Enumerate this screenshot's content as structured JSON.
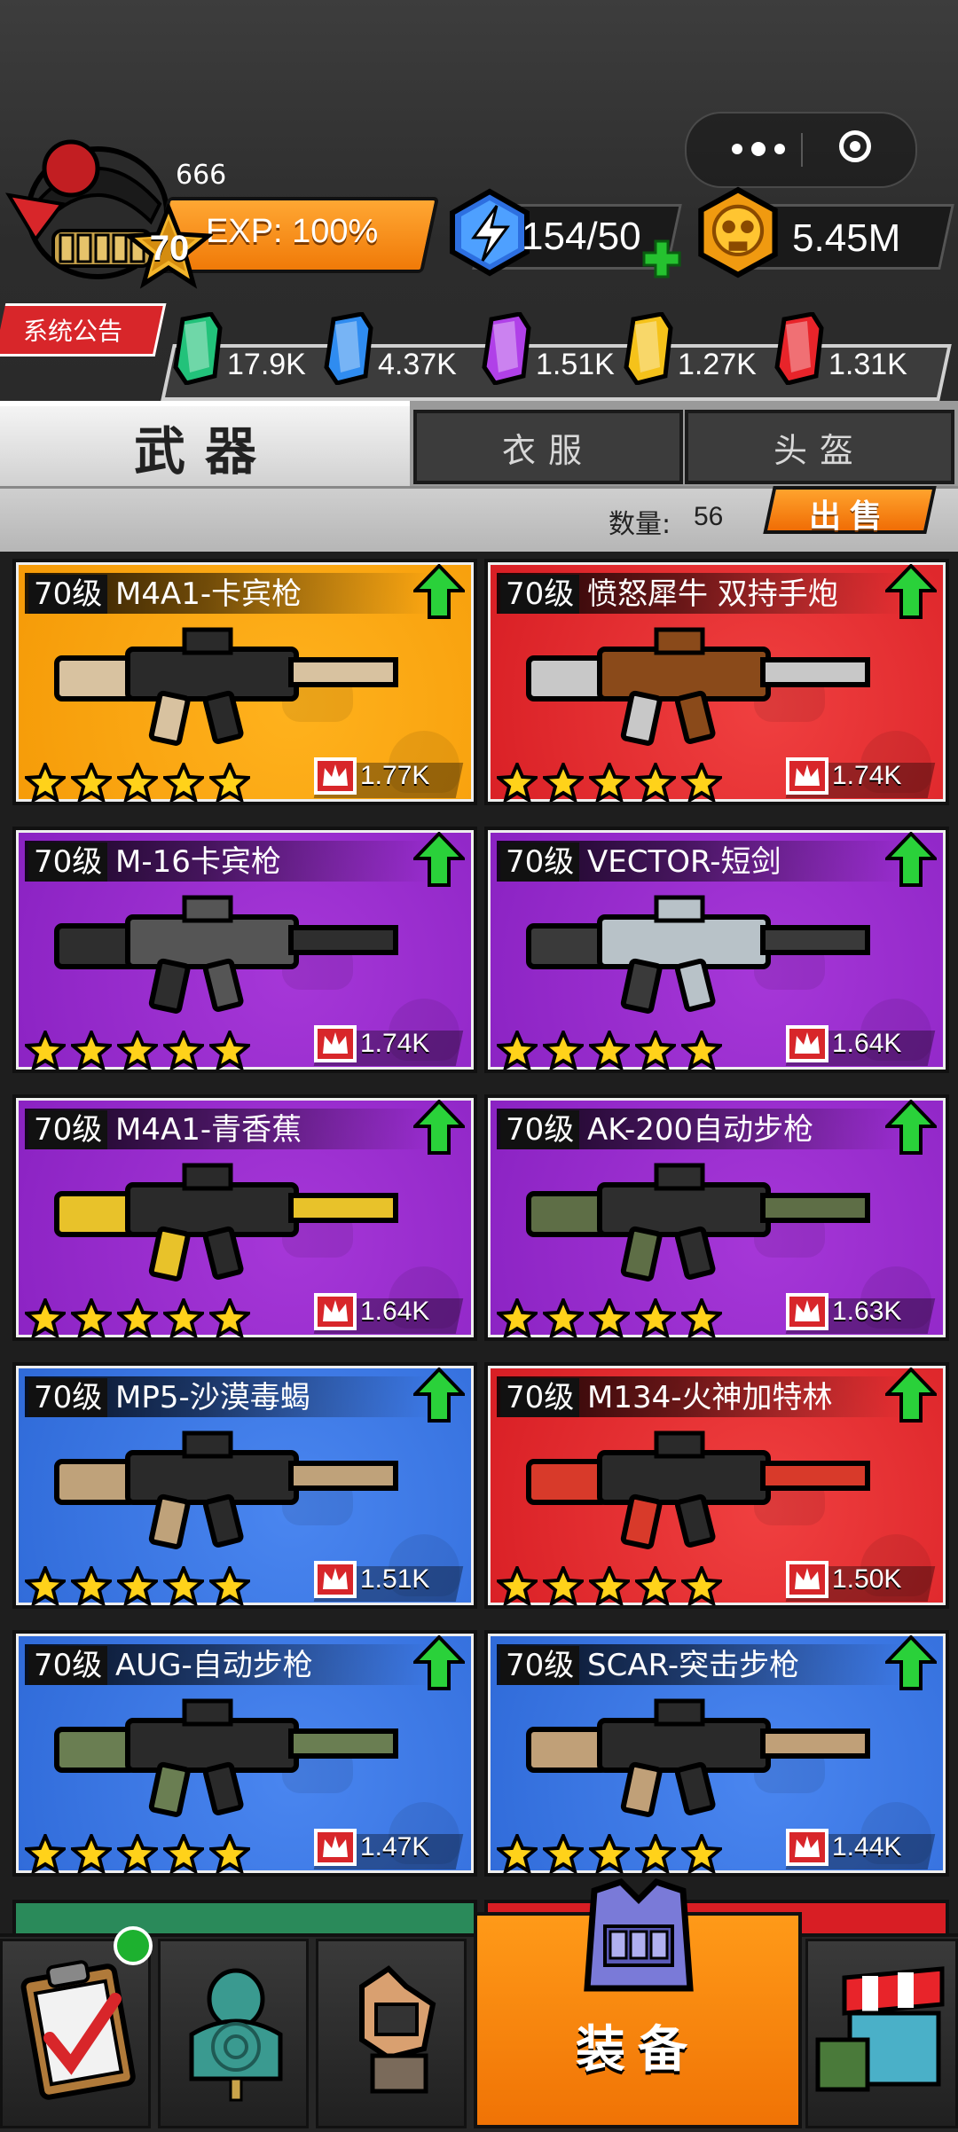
{
  "player": {
    "name": "666",
    "level": "70",
    "exp": "EXP: 100%",
    "energy": "154/50",
    "coins": "5.45M"
  },
  "announcement": "系统公告",
  "gems": [
    {
      "color": "#22c27a",
      "value": "17.9K"
    },
    {
      "color": "#2f8cf0",
      "value": "4.37K"
    },
    {
      "color": "#b040e8",
      "value": "1.51K"
    },
    {
      "color": "#f5c21a",
      "value": "1.27K"
    },
    {
      "color": "#e8242a",
      "value": "1.31K"
    }
  ],
  "tabs": {
    "active": "武器",
    "others": [
      "衣服",
      "头盔"
    ]
  },
  "inventory": {
    "count_label": "数量:",
    "count_value": "56",
    "sell_label": "出售"
  },
  "weapons": [
    {
      "level": "70级",
      "name": "M4A1-卡宾枪",
      "rarity": "orange",
      "stars": 5,
      "power": "1.77K",
      "gun": "m4a1-tan"
    },
    {
      "level": "70级",
      "name": "愤怒犀牛 双持手炮",
      "rarity": "red",
      "stars": 5,
      "power": "1.74K",
      "gun": "revolver-cannon"
    },
    {
      "level": "70级",
      "name": "M-16卡宾枪",
      "rarity": "purple",
      "stars": 5,
      "power": "1.74K",
      "gun": "m16-black"
    },
    {
      "level": "70级",
      "name": "VECTOR-短剑",
      "rarity": "purple",
      "stars": 5,
      "power": "1.64K",
      "gun": "vector"
    },
    {
      "level": "70级",
      "name": "M4A1-青香蕉",
      "rarity": "purple",
      "stars": 5,
      "power": "1.64K",
      "gun": "m4a1-yellow"
    },
    {
      "level": "70级",
      "name": "AK-200自动步枪",
      "rarity": "purple",
      "stars": 5,
      "power": "1.63K",
      "gun": "ak200"
    },
    {
      "level": "70级",
      "name": "MP5-沙漠毒蝎",
      "rarity": "blue",
      "stars": 5,
      "power": "1.51K",
      "gun": "mp5-tan"
    },
    {
      "level": "70级",
      "name": "M134-火神加特林",
      "rarity": "red",
      "stars": 5,
      "power": "1.50K",
      "gun": "minigun"
    },
    {
      "level": "70级",
      "name": "AUG-自动步枪",
      "rarity": "blue",
      "stars": 5,
      "power": "1.47K",
      "gun": "aug-green"
    },
    {
      "level": "70级",
      "name": "SCAR-突击步枪",
      "rarity": "blue",
      "stars": 5,
      "power": "1.44K",
      "gun": "scar-tan"
    }
  ],
  "nav": {
    "items": [
      "clipboard-icon",
      "target-icon",
      "glove-icon",
      "armor-vest-icon",
      "shop-icon"
    ],
    "active_label": "装备"
  },
  "colors": {
    "orange": "#f59a07",
    "red": "#d81e24",
    "purple": "#8a22c2",
    "blue": "#2f6ad8",
    "accent_green": "#1db12f"
  }
}
